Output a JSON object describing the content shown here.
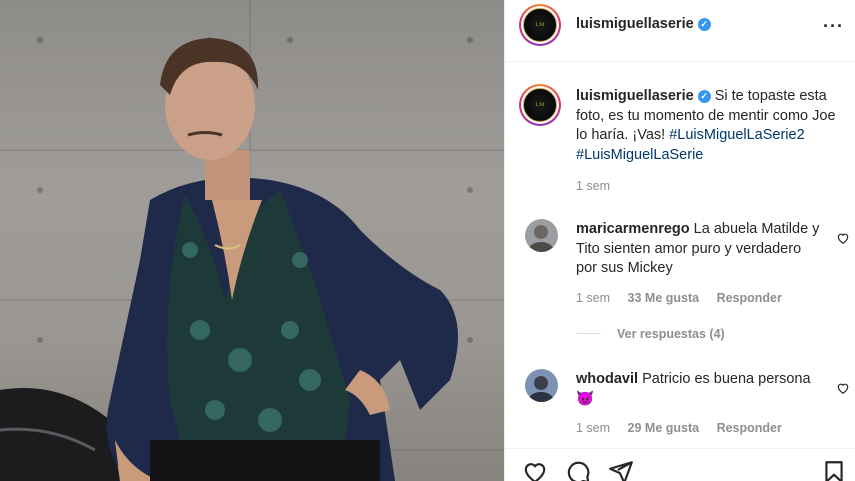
{
  "post": {
    "username": "luismiguellaserie",
    "verified": true,
    "avatar_mark": "LM",
    "caption": {
      "text": "Si te topaste esta foto, es tu momento de mentir como Joe lo haría. ¡Vas!",
      "hashtags": [
        "#LuisMiguelLaSerie2",
        "#LuisMiguelLaSerie"
      ],
      "time": "1 sem"
    }
  },
  "comments": [
    {
      "username": "maricarmenrego",
      "text": "La abuela Matilde y Tito sienten amor puro y verdadero por sus Mickey",
      "time": "1 sem",
      "likes": "33 Me gusta",
      "reply_label": "Responder",
      "view_replies": "Ver respuestas (4)"
    },
    {
      "username": "whodavil",
      "text": "Patricio es buena persona",
      "emoji": "😈",
      "time": "1 sem",
      "likes": "29 Me gusta",
      "reply_label": "Responder"
    }
  ],
  "icons": {
    "more": "more-options-icon",
    "verified": "verified-badge-icon",
    "like": "heart-icon",
    "comment": "comment-bubble-icon",
    "share": "paper-plane-icon",
    "save": "bookmark-icon"
  },
  "colors": {
    "accent_blue": "#3897f0",
    "hashtag": "#00376b",
    "muted": "#8e8e8e",
    "text": "#262626"
  }
}
